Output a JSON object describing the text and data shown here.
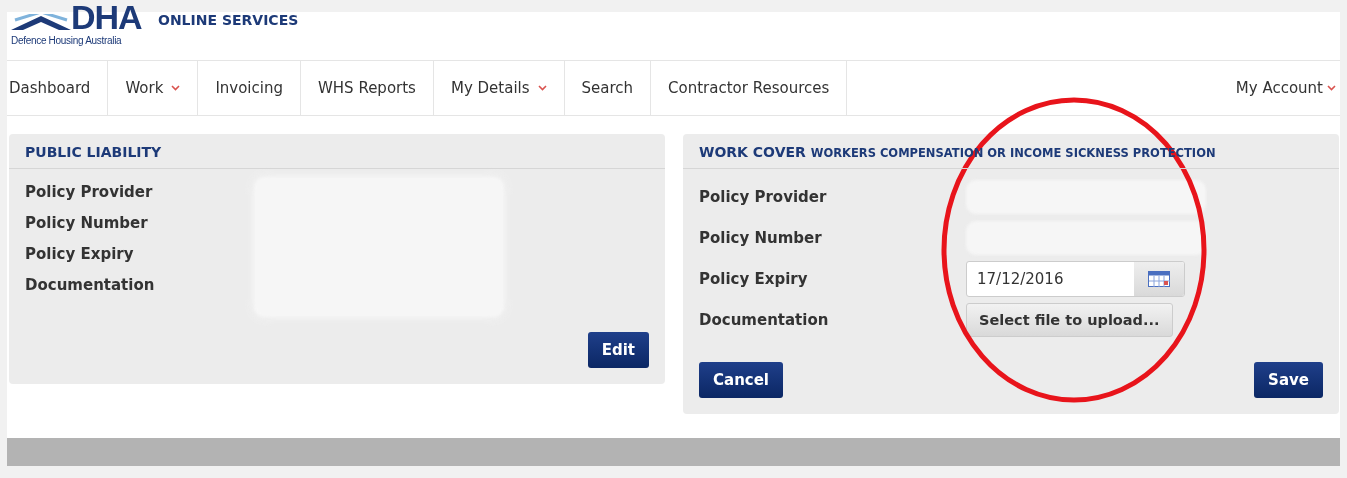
{
  "logo": {
    "mark": "DHA",
    "subtitle": "Defence Housing Australia",
    "service": "ONLINE SERVICES"
  },
  "nav": {
    "items": [
      {
        "label": "Dashboard",
        "dropdown": false
      },
      {
        "label": "Work",
        "dropdown": true
      },
      {
        "label": "Invoicing",
        "dropdown": false
      },
      {
        "label": "WHS Reports",
        "dropdown": false
      },
      {
        "label": "My Details",
        "dropdown": true
      },
      {
        "label": "Search",
        "dropdown": false
      },
      {
        "label": "Contractor Resources",
        "dropdown": false
      }
    ],
    "account": {
      "label": "My Account",
      "dropdown": true
    }
  },
  "public_liability": {
    "title": "PUBLIC LIABILITY",
    "labels": [
      "Policy Provider",
      "Policy Number",
      "Policy Expiry",
      "Documentation"
    ],
    "button": "Edit"
  },
  "work_cover": {
    "title": "WORK COVER",
    "subtitle": "WORKERS COMPENSATION OR INCOME SICKNESS PROTECTION",
    "rows": [
      {
        "label": "Policy Provider",
        "kind": "redacted"
      },
      {
        "label": "Policy Number",
        "kind": "redacted"
      },
      {
        "label": "Policy Expiry",
        "kind": "date",
        "value": "17/12/2016"
      },
      {
        "label": "Documentation",
        "kind": "file",
        "button": "Select file to upload..."
      }
    ],
    "cancel": "Cancel",
    "save": "Save"
  }
}
